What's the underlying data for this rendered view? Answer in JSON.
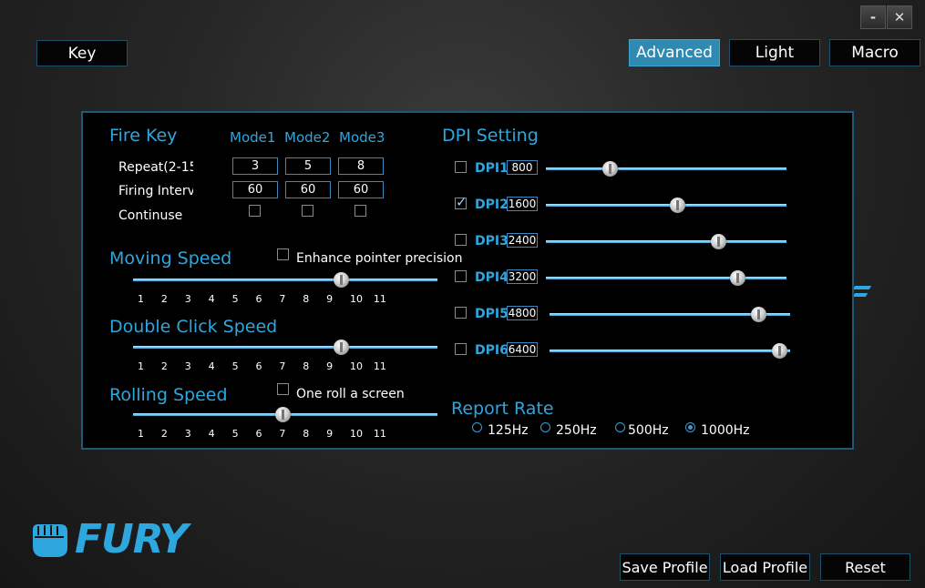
{
  "window": {
    "minimize_label": "-",
    "close_label": "✕"
  },
  "tabs": {
    "key": "Key",
    "advanced": "Advanced",
    "light": "Light",
    "macro": "Macro"
  },
  "fire_key": {
    "title": "Fire Key",
    "modes": [
      "Mode1",
      "Mode2",
      "Mode3"
    ],
    "repeat_label": "Repeat(2-15",
    "interval_label": "Firing Interv",
    "continuse_label": "Continuse",
    "repeat_values": [
      "3",
      "5",
      "8"
    ],
    "interval_values": [
      "60",
      "60",
      "60"
    ]
  },
  "moving_speed": {
    "title": "Moving Speed",
    "enhance_label": "Enhance pointer precision",
    "value": 8
  },
  "double_click": {
    "title": "Double Click Speed",
    "value": 8
  },
  "rolling": {
    "title": "Rolling Speed",
    "one_roll_label": "One roll a screen",
    "value": 6
  },
  "ticks": [
    "1",
    "2",
    "3",
    "4",
    "5",
    "6",
    "7",
    "8",
    "9",
    "10",
    "11"
  ],
  "dpi": {
    "title": "DPI Setting",
    "items": [
      {
        "label": "DPI1",
        "value": "800",
        "checked": false,
        "level": 0.27
      },
      {
        "label": "DPI2",
        "value": "1600",
        "checked": true,
        "level": 0.55
      },
      {
        "label": "DPI3",
        "value": "2400",
        "checked": false,
        "level": 0.72
      },
      {
        "label": "DPI4",
        "value": "3200",
        "checked": false,
        "level": 0.8
      },
      {
        "label": "DPI5",
        "value": "4800",
        "checked": false,
        "level": 0.87
      },
      {
        "label": "DPI6",
        "value": "6400",
        "checked": false,
        "level": 0.96
      }
    ]
  },
  "report_rate": {
    "title": "Report Rate",
    "options": [
      "125Hz",
      "250Hz",
      "500Hz",
      "1000Hz"
    ],
    "selected": "1000Hz"
  },
  "brand": {
    "name": "FURY"
  },
  "footer": {
    "save": "Save Profile",
    "load": "Load Profile",
    "reset": "Reset"
  },
  "colors": {
    "accent": "#2ea6de",
    "active_tab": "#2f8ab2",
    "panel_border": "#1e5a78"
  }
}
